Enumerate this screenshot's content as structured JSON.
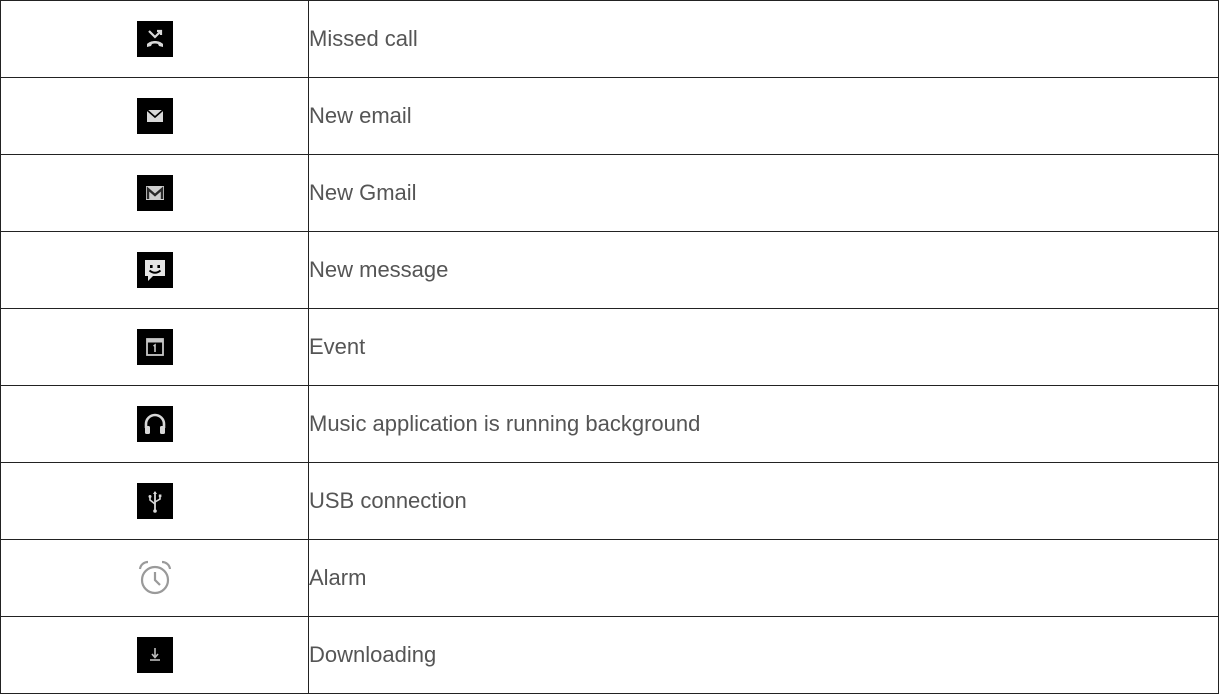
{
  "rows": [
    {
      "icon": "missed-call-icon",
      "label": "Missed call"
    },
    {
      "icon": "email-icon",
      "label": "New email"
    },
    {
      "icon": "gmail-icon",
      "label": "New Gmail"
    },
    {
      "icon": "message-icon",
      "label": "New message"
    },
    {
      "icon": "calendar-event-icon",
      "label": "Event"
    },
    {
      "icon": "headphones-icon",
      "label": "Music application is running background"
    },
    {
      "icon": "usb-icon",
      "label": "USB connection"
    },
    {
      "icon": "alarm-clock-icon",
      "label": "Alarm"
    },
    {
      "icon": "download-icon",
      "label": "Downloading"
    }
  ],
  "colors": {
    "icon_bg": "#000000",
    "icon_fg": "#d8d8d8",
    "text": "#555555",
    "border": "#222222"
  }
}
